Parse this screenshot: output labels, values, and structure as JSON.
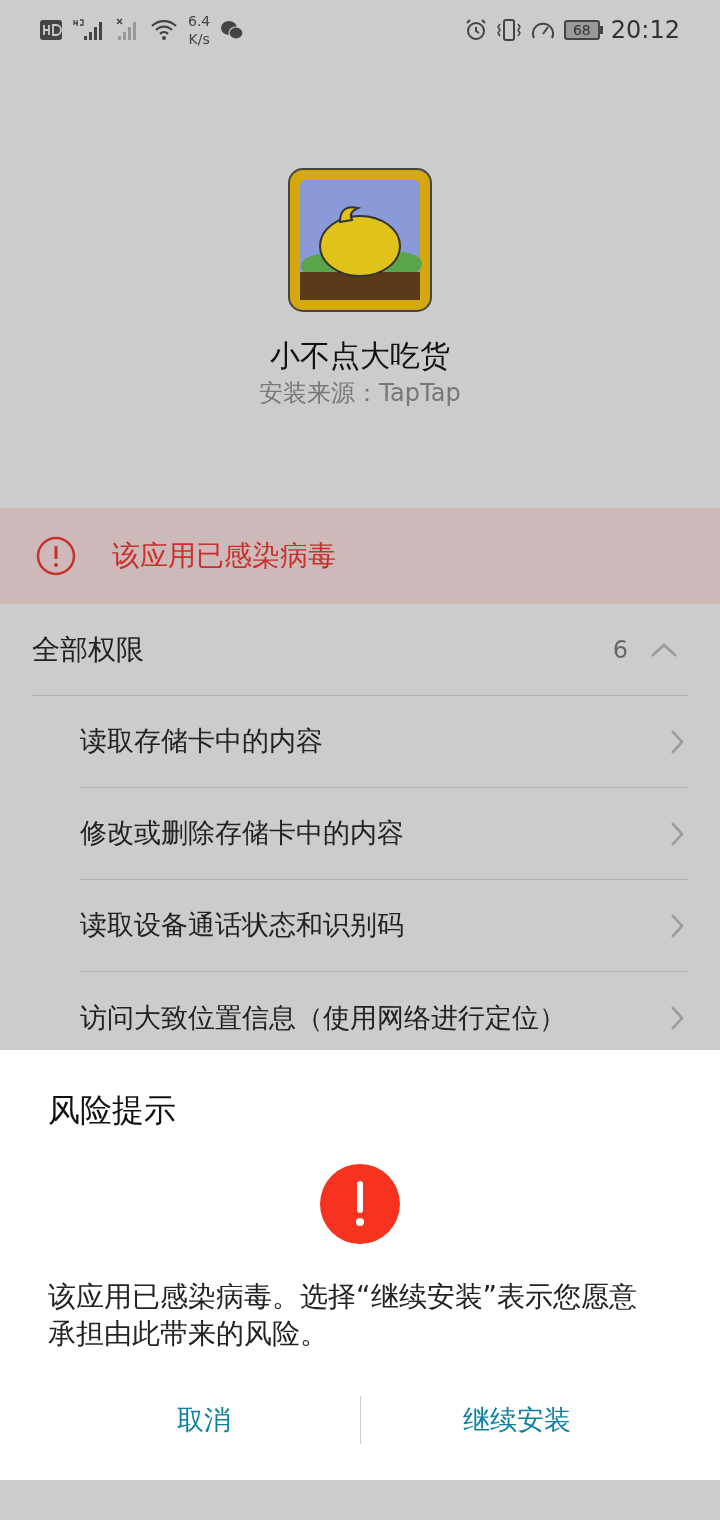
{
  "status_bar": {
    "network_speed": "6.4",
    "speed_unit": "K/s",
    "battery": "68",
    "time": "20:12"
  },
  "app": {
    "name": "小不点大吃货",
    "source": "安装来源：TapTap"
  },
  "warning": {
    "text": "该应用已感染病毒"
  },
  "permissions": {
    "title": "全部权限",
    "count": "6",
    "expanded": true,
    "items": [
      {
        "label": "读取存储卡中的内容"
      },
      {
        "label": "修改或删除存储卡中的内容"
      },
      {
        "label": "读取设备通话状态和识别码"
      },
      {
        "label": "访问大致位置信息（使用网络进行定位）"
      }
    ]
  },
  "dialog": {
    "title": "风险提示",
    "message": "该应用已感染病毒。选择“继续安装”表示您愿意承担由此带来的风险。",
    "buttons": [
      {
        "label": "取消"
      },
      {
        "label": "继续安装"
      }
    ]
  }
}
